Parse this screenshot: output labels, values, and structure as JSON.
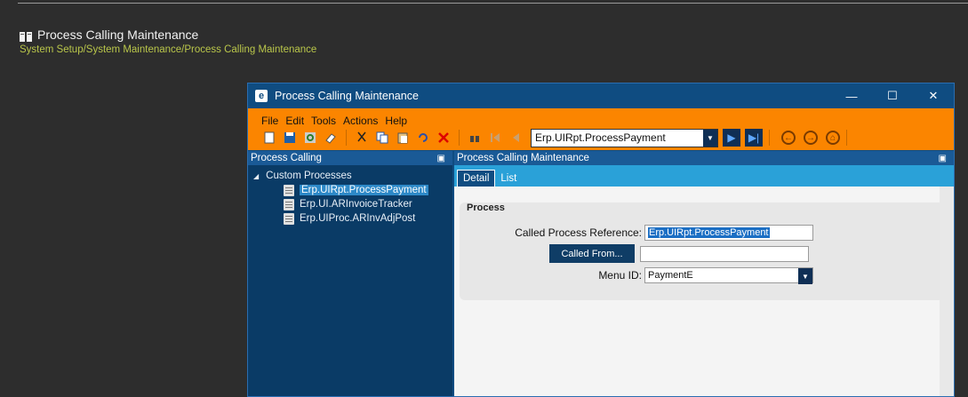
{
  "page": {
    "title": "Process Calling Maintenance",
    "breadcrumb": "System Setup/System Maintenance/Process Calling Maintenance"
  },
  "window": {
    "title": "Process Calling Maintenance",
    "logo": "e",
    "controls": {
      "minimize": "—",
      "maximize": "☐",
      "close": "✕"
    }
  },
  "menu": [
    "File",
    "Edit",
    "Tools",
    "Actions",
    "Help"
  ],
  "toolbar": {
    "combo_value": "Erp.UIRpt.ProcessPayment"
  },
  "left_pane": {
    "header": "Process Calling",
    "tree_root": "Custom Processes",
    "items": [
      "Erp.UIRpt.ProcessPayment",
      "Erp.UI.ARInvoiceTracker",
      "Erp.UIProc.ARInvAdjPost"
    ]
  },
  "right_pane": {
    "header": "Process Calling Maintenance",
    "tabs": [
      "Detail",
      "List"
    ],
    "group_title": "Process",
    "called_ref_label": "Called Process Reference:",
    "called_ref_value": "Erp.UIRpt.ProcessPayment",
    "called_from_label": "Called From...",
    "called_from_value": "",
    "menu_id_label": "Menu ID:",
    "menu_id_value": "PaymentE"
  },
  "colors": {
    "accent": "#fb8500",
    "window": "#0f4c81",
    "breadcrumb": "#b9c64a"
  }
}
